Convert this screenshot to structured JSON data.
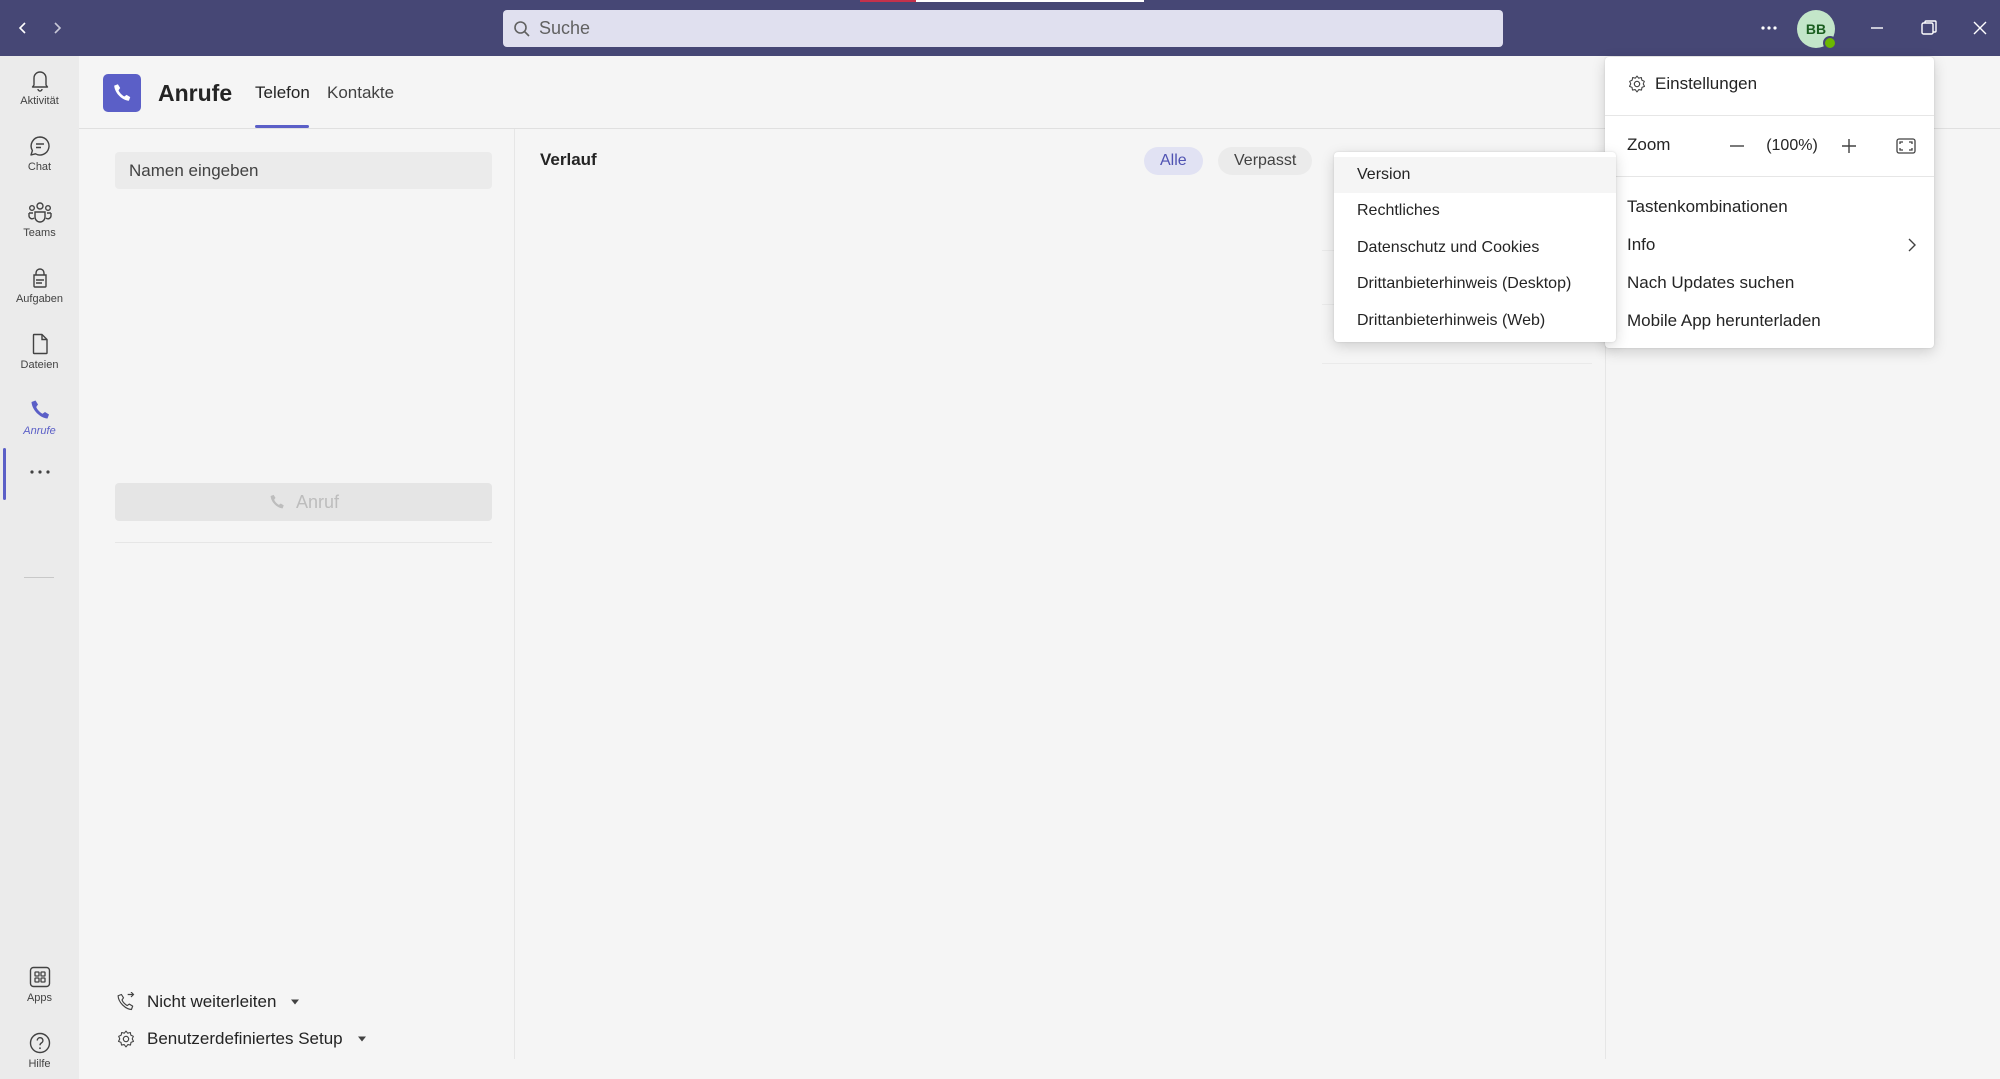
{
  "titlebar": {
    "search_placeholder": "Suche",
    "avatar_initials": "BB",
    "colors": {
      "background": "#464775",
      "presence": "#6bb700"
    }
  },
  "appbar": {
    "items": [
      {
        "label": "Aktivität",
        "icon": "bell-icon"
      },
      {
        "label": "Chat",
        "icon": "chat-icon"
      },
      {
        "label": "Teams",
        "icon": "teams-icon"
      },
      {
        "label": "Aufgaben",
        "icon": "tasks-icon"
      },
      {
        "label": "Dateien",
        "icon": "file-icon"
      },
      {
        "label": "Anrufe",
        "icon": "phone-icon",
        "active": true
      }
    ],
    "bottom_items": [
      {
        "label": "Apps",
        "icon": "apps-icon"
      },
      {
        "label": "Hilfe",
        "icon": "help-icon"
      }
    ]
  },
  "header": {
    "title": "Anrufe",
    "tabs": [
      {
        "label": "Telefon",
        "active": true
      },
      {
        "label": "Kontakte"
      }
    ]
  },
  "left_pane": {
    "name_input_placeholder": "Namen eingeben",
    "call_button_label": "Anruf",
    "forwarding_label": "Nicht weiterleiten",
    "setup_label": "Benutzerdefiniertes Setup"
  },
  "main": {
    "history_title": "Verlauf",
    "filters": [
      {
        "label": "Alle",
        "active": true
      },
      {
        "label": "Verpasst"
      }
    ]
  },
  "settings_menu": {
    "settings_label": "Einstellungen",
    "zoom_label": "Zoom",
    "zoom_value": "(100%)",
    "shortcuts_label": "Tastenkombinationen",
    "info_label": "Info",
    "updates_label": "Nach Updates suchen",
    "mobile_label": "Mobile App herunterladen"
  },
  "info_submenu": {
    "items": [
      "Version",
      "Rechtliches",
      "Datenschutz und Cookies",
      "Drittanbieterhinweis (Desktop)",
      "Drittanbieterhinweis (Web)"
    ]
  },
  "colors": {
    "accent": "#5b5fc7",
    "accent_light": "#e1e2f3"
  }
}
